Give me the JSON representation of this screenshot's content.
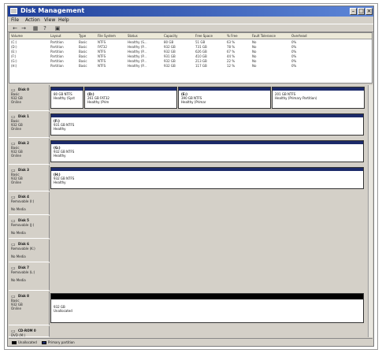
{
  "window": {
    "title": "Disk Management"
  },
  "menu": [
    "File",
    "Action",
    "View",
    "Help"
  ],
  "toolbar": [
    "←",
    "→",
    "▦",
    "?",
    "▣"
  ],
  "volume_table": {
    "headers": [
      "Volume",
      "Layout",
      "Type",
      "File System",
      "Status",
      "Capacity",
      "Free Space",
      "% Free",
      "Fault Tolerance",
      "Overhead"
    ],
    "rows": [
      [
        "(C:)",
        "Partition",
        "Basic",
        "NTFS",
        "Healthy (S...",
        "80 GB",
        "51 GB",
        "63 %",
        "No",
        "0%"
      ],
      [
        "(D:)",
        "Partition",
        "Basic",
        "FAT32",
        "Healthy (P...",
        "932 GB",
        "731 GB",
        "78 %",
        "No",
        "0%"
      ],
      [
        "(E:)",
        "Partition",
        "Basic",
        "NTFS",
        "Healthy (P...",
        "932 GB",
        "626 GB",
        "67 %",
        "No",
        "0%"
      ],
      [
        "(F:)",
        "Partition",
        "Basic",
        "NTFS",
        "Healthy (P...",
        "931 GB",
        "410 GB",
        "44 %",
        "No",
        "0%"
      ],
      [
        "(G:)",
        "Partition",
        "Basic",
        "NTFS",
        "Healthy (P...",
        "932 GB",
        "213 GB",
        "22 %",
        "No",
        "0%"
      ],
      [
        "(H:)",
        "Partition",
        "Basic",
        "NTFS",
        "Healthy (P...",
        "932 GB",
        "117 GB",
        "12 %",
        "No",
        "0%"
      ]
    ]
  },
  "disks": [
    {
      "name": "Disk 0",
      "lines": [
        "Basic",
        "932 GB",
        "Online"
      ],
      "parts": [
        {
          "title": "",
          "lines": [
            "80 GB NTFS",
            "Healthy (Syst"
          ]
        },
        {
          "title": "(D:)",
          "lines": [
            "261 GB FAT32",
            "Healthy (Prim"
          ]
        },
        {
          "title": "(E:)",
          "lines": [
            "390 GB NTFS",
            "Healthy (Primar"
          ]
        },
        {
          "title": "",
          "lines": [
            "201 GB NTFS",
            "Healthy (Primary Partition)"
          ]
        }
      ]
    },
    {
      "name": "Disk 1",
      "lines": [
        "Basic",
        "932 GB",
        "Online"
      ],
      "parts": [
        {
          "title": "(F:)",
          "lines": [
            "931 GB NTFS",
            "Healthy"
          ]
        }
      ]
    },
    {
      "name": "Disk 2",
      "lines": [
        "Basic",
        "932 GB",
        "Online"
      ],
      "parts": [
        {
          "title": "(G:)",
          "lines": [
            "932 GB NTFS",
            "Healthy"
          ]
        }
      ]
    },
    {
      "name": "Disk 3",
      "lines": [
        "Basic",
        "932 GB",
        "Online"
      ],
      "parts": [
        {
          "title": "(H:)",
          "lines": [
            "932 GB NTFS",
            "Healthy"
          ]
        }
      ]
    },
    {
      "name": "Disk 4",
      "lines": [
        "Removable (I:)",
        "",
        "No Media"
      ],
      "parts": []
    },
    {
      "name": "Disk 5",
      "lines": [
        "Removable (J:)",
        "",
        "No Media"
      ],
      "parts": []
    },
    {
      "name": "Disk 6",
      "lines": [
        "Removable (K:)",
        "",
        "No Media"
      ],
      "parts": []
    },
    {
      "name": "Disk 7",
      "lines": [
        "Removable (L:)",
        "",
        "No Media"
      ],
      "parts": []
    },
    {
      "name": "Disk 8",
      "lines": [
        "Basic",
        "932 GB",
        "Online"
      ],
      "parts": [
        {
          "title": "",
          "black": true,
          "lines": [
            "932 GB",
            "Unallocated"
          ]
        }
      ]
    },
    {
      "name": "CD-ROM 0",
      "lines": [
        "DVD (M:)"
      ],
      "parts": []
    }
  ],
  "legend": [
    "Unallocated",
    "Primary partition"
  ],
  "colors": {
    "partition_strip": "#1c2a6a",
    "unallocated_strip": "#000000",
    "titlebar_start": "#1f3f9a"
  }
}
